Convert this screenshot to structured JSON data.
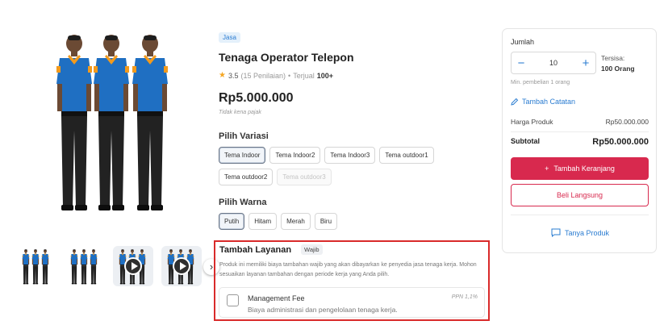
{
  "gallery": {
    "thumbs": [
      {
        "kind": "image",
        "active": false
      },
      {
        "kind": "image",
        "active": false
      },
      {
        "kind": "video",
        "active": true
      },
      {
        "kind": "video",
        "active": true
      }
    ],
    "next_icon": "chevron-right-icon"
  },
  "product": {
    "category_badge": "Jasa",
    "title": "Tenaga Operator Telepon",
    "rating": "3.5",
    "reviews": "(15 Penilaian)",
    "separator": "•",
    "sold_label": "Terjual",
    "sold_value": "100+",
    "price": "Rp5.000.000",
    "tax_note": "Tidak kena pajak"
  },
  "variants": {
    "title": "Pilih Variasi",
    "options": [
      {
        "label": "Tema Indoor",
        "state": "selected"
      },
      {
        "label": "Tema Indoor2",
        "state": "normal"
      },
      {
        "label": "Tema Indoor3",
        "state": "normal"
      },
      {
        "label": "Tema outdoor1",
        "state": "normal"
      },
      {
        "label": "Tema outdoor2",
        "state": "normal"
      },
      {
        "label": "Tema outdoor3",
        "state": "disabled"
      }
    ]
  },
  "colors": {
    "title": "Pilih Warna",
    "options": [
      {
        "label": "Putih",
        "state": "selected"
      },
      {
        "label": "Hitam",
        "state": "normal"
      },
      {
        "label": "Merah",
        "state": "normal"
      },
      {
        "label": "Biru",
        "state": "normal"
      }
    ]
  },
  "addon": {
    "title": "Tambah Layanan",
    "badge": "Wajib",
    "description": "Produk ini memiliki biaya tambahan wajib yang akan dibayarkan ke penyedia jasa tenaga kerja. Mohon sesuaikan layanan tambahan dengan periode kerja yang Anda pilih.",
    "fee_name": "Management Fee",
    "fee_desc": "Biaya administrasi dan pengelolaan tenaga kerja.",
    "fee_tax": "PPN 1,1%",
    "checked": false
  },
  "purchase": {
    "qty_label": "Jumlah",
    "qty_value": "10",
    "stock_label": "Tersisa:",
    "stock_value": "100 Orang",
    "min_note": "Min. pembelian 1 orang",
    "note_link": "Tambah Catatan",
    "product_price_label": "Harga Produk",
    "product_price_value": "Rp50.000.000",
    "subtotal_label": "Subtotal",
    "subtotal_value": "Rp50.000.000",
    "add_cart": "Tambah Keranjang",
    "buy_now": "Beli Langsung",
    "ask": "Tanya Produk"
  },
  "colors_theme": {
    "primary": "#d8294e",
    "link": "#2a7cd1",
    "highlight_border": "#d92a2a",
    "shirt_blue": "#1f6fc2",
    "collar_orange": "#f29a1d"
  }
}
